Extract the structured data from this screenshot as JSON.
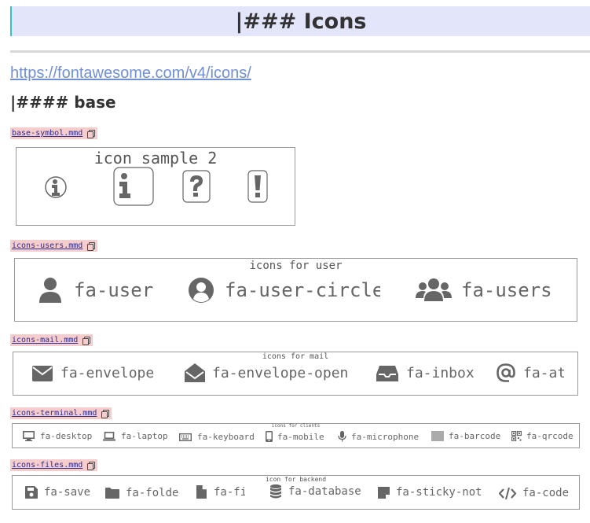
{
  "heading": {
    "title": "|### Icons"
  },
  "link": {
    "text": "https://fontawesome.com/v4/icons/"
  },
  "subheading": {
    "title": "|#### base"
  },
  "sections": [
    {
      "file": "base-symbol.mmd",
      "diagram_title": "icon sample 2",
      "icons": [
        "info-circle",
        "info",
        "question",
        "exclamation"
      ]
    },
    {
      "file": "icons-users.mmd",
      "diagram_title": "icons for user",
      "items": [
        {
          "icon": "user",
          "label": "fa-user"
        },
        {
          "icon": "user-circle",
          "label": "fa-user-circle"
        },
        {
          "icon": "users",
          "label": "fa-users"
        }
      ]
    },
    {
      "file": "icons-mail.mmd",
      "diagram_title": "icons for mail",
      "items": [
        {
          "icon": "envelope",
          "label": "fa-envelope"
        },
        {
          "icon": "envelope-open",
          "label": "fa-envelope-open"
        },
        {
          "icon": "inbox",
          "label": "fa-inbox"
        },
        {
          "icon": "at",
          "label": "fa-at"
        }
      ]
    },
    {
      "file": "icons-terminal.mmd",
      "diagram_title": "icons for clients",
      "items": [
        {
          "icon": "desktop",
          "label": "fa-desktop"
        },
        {
          "icon": "laptop",
          "label": "fa-laptop"
        },
        {
          "icon": "keyboard",
          "label": "fa-keyboard"
        },
        {
          "icon": "mobile",
          "label": "fa-mobile"
        },
        {
          "icon": "microphone",
          "label": "fa-microphone"
        },
        {
          "icon": "barcode",
          "label": "fa-barcode"
        },
        {
          "icon": "qrcode",
          "label": "fa-qrcode"
        }
      ]
    },
    {
      "file": "icons-files.mmd",
      "diagram_title": "icon for backend",
      "items": [
        {
          "icon": "save",
          "label": "fa-save"
        },
        {
          "icon": "folder",
          "label": "fa-folder"
        },
        {
          "icon": "file",
          "label": "fa-file"
        },
        {
          "icon": "database",
          "label": "fa-database"
        },
        {
          "icon": "sticky-note",
          "label": "fa-sticky-note"
        },
        {
          "icon": "code",
          "label": "fa-code"
        }
      ]
    }
  ],
  "colors": {
    "header_bg": "#e3e6fb",
    "header_accent": "#35c2c2",
    "file_tag_bg": "#f7cccc",
    "link": "#6f8fd6",
    "icon": "#666666"
  }
}
